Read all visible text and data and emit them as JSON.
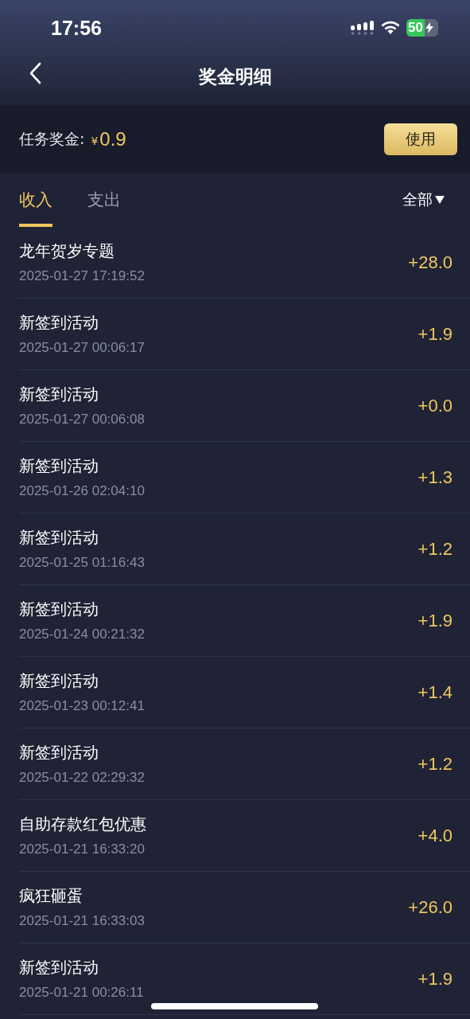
{
  "status_bar": {
    "time": "17:56",
    "battery": "50"
  },
  "nav": {
    "title": "奖金明细"
  },
  "bonus": {
    "label": "任务奖金:",
    "currency": "¥",
    "amount": "0.9",
    "button": "使用"
  },
  "tabs": [
    {
      "label": "收入",
      "selected": true
    },
    {
      "label": "支出",
      "selected": false
    }
  ],
  "filter": {
    "label": "全部"
  },
  "records": [
    {
      "title": "龙年贺岁专题",
      "time": "2025-01-27 17:19:52",
      "amount": "+28.0"
    },
    {
      "title": "新签到活动",
      "time": "2025-01-27 00:06:17",
      "amount": "+1.9"
    },
    {
      "title": "新签到活动",
      "time": "2025-01-27 00:06:08",
      "amount": "+0.0"
    },
    {
      "title": "新签到活动",
      "time": "2025-01-26 02:04:10",
      "amount": "+1.3"
    },
    {
      "title": "新签到活动",
      "time": "2025-01-25 01:16:43",
      "amount": "+1.2"
    },
    {
      "title": "新签到活动",
      "time": "2025-01-24 00:21:32",
      "amount": "+1.9"
    },
    {
      "title": "新签到活动",
      "time": "2025-01-23 00:12:41",
      "amount": "+1.4"
    },
    {
      "title": "新签到活动",
      "time": "2025-01-22 02:29:32",
      "amount": "+1.2"
    },
    {
      "title": "自助存款红包优惠",
      "time": "2025-01-21 16:33:20",
      "amount": "+4.0"
    },
    {
      "title": "疯狂砸蛋",
      "time": "2025-01-21 16:33:03",
      "amount": "+26.0"
    },
    {
      "title": "新签到活动",
      "time": "2025-01-21 00:26:11",
      "amount": "+1.9"
    }
  ]
}
